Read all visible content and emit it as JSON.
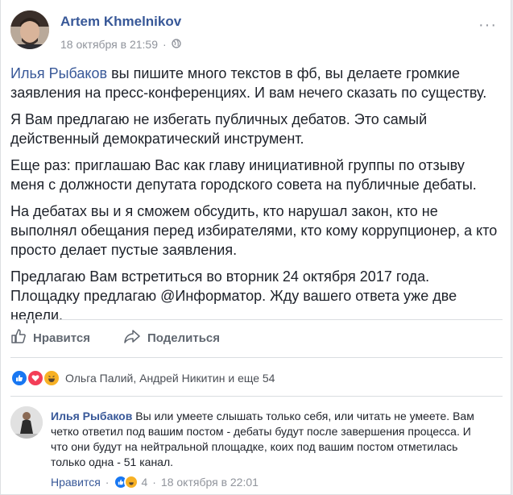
{
  "post": {
    "author": "Artem Khmelnikov",
    "timestamp": "18 октября в 21:59",
    "separator": "·",
    "more": "···",
    "mention": "Илья Рыбаков",
    "p1_rest": " вы пишите много текстов в фб, вы делаете громкие заявления на пресс-конференциях. И вам нечего сказать по существу.",
    "p2": "Я Вам предлагаю не избегать публичных дебатов. Это самый действенный демократический инструмент.",
    "p3": "Еще раз: приглашаю Вас как главу инициативной группы по отзыву меня с должности депутата городского совета на публичные дебаты.",
    "p4": "На дебатах вы и я сможем обсудить, кто нарушал закон, кто не выполнял обещания перед избирателями, кто кому коррупционер, а кто просто делает пустые заявления.",
    "p5": "Предлагаю Вам встретиться во вторник 24 октября 2017 года. Площадку предлагаю @Информатор. Жду вашего ответа уже две недели."
  },
  "actions": {
    "like": "Нравится",
    "share": "Поделиться"
  },
  "reactions": {
    "names": "Ольга Палий, Андрей Никитин и еще 54"
  },
  "comment": {
    "author": "Илья Рыбаков",
    "text": " Вы или умеете слышать только себя, или читать не умеете. Вам четко ответил под вашим постом - дебаты будут после завершения процесса. И что они будут на нейтральной площадке, коих под вашим постом отметилась только одна - 51 канал.",
    "like": "Нравится",
    "dot": "·",
    "count": "4",
    "time": "18 октября в 22:01"
  },
  "colors": {
    "link": "#385898",
    "like_blue": "#1877f2",
    "love_red": "#f33e58",
    "haha_yellow": "#f7b125"
  }
}
